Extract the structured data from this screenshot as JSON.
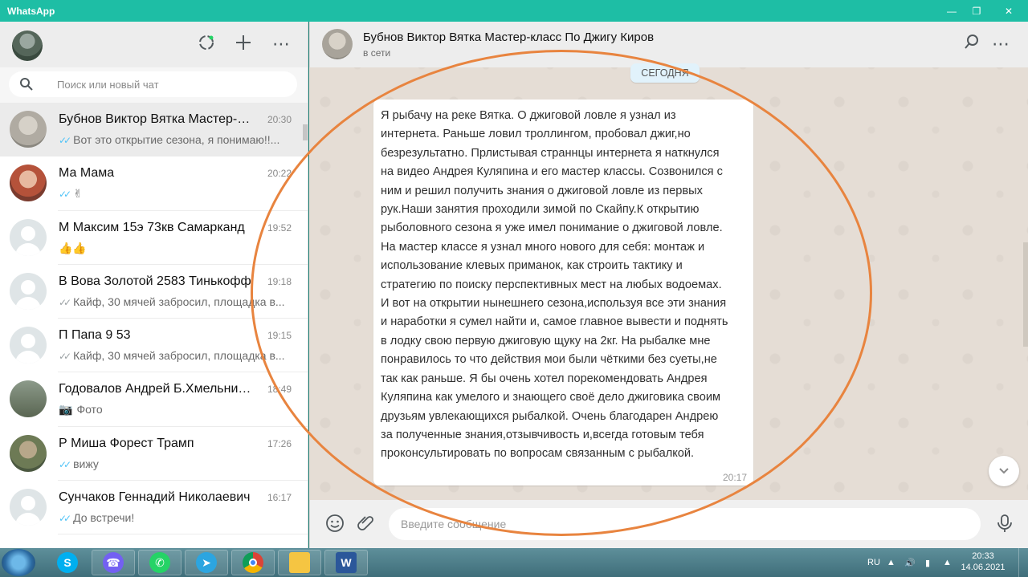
{
  "window": {
    "title": "WhatsApp"
  },
  "search": {
    "placeholder": "Поиск или новый чат"
  },
  "chats": [
    {
      "name": "Бубнов Виктор Вятка Мастер-класс По Джигу Киров",
      "time": "20:30",
      "preview": "Вот это открытие сезона, я понимаю!!...",
      "ticks": true,
      "active": true
    },
    {
      "name": "Ма Мама",
      "time": "20:22",
      "preview": "✌",
      "ticks": true
    },
    {
      "name": "М Максим 15э 73кв Самарканд",
      "time": "19:52",
      "preview": "👍👍",
      "ticks": false
    },
    {
      "name": "В Вова Золотой 2583 Тинькофф",
      "time": "19:18",
      "preview": "Кайф, 30 мячей забросил, площадка в...",
      "ticks": true
    },
    {
      "name": "П Папа 9 53",
      "time": "19:15",
      "preview": "Кайф, 30 мячей забросил, площадка в...",
      "ticks": true
    },
    {
      "name": "Годовалов Андрей Б.Хмельницкий",
      "time": "18:49",
      "preview": "Фото",
      "ticks": false,
      "photo": true
    },
    {
      "name": "Р Миша Форест Трамп",
      "time": "17:26",
      "preview": "вижу",
      "ticks": true
    },
    {
      "name": "Сунчаков Геннадий Николаевич",
      "time": "16:17",
      "preview": "До встречи!",
      "ticks": true
    }
  ],
  "conversation": {
    "contact_name": "Бубнов Виктор Вятка Мастер-класс По Джигу Киров",
    "status": "в сети",
    "date_label": "СЕГОДНЯ",
    "message_lines": [
      "Я рыбачу на реке Вятка. О джиговой ловле я узнал из",
      "интернета. Раньше ловил троллингом, пробовал джиг,но",
      "безрезультатно. Прлистывая страннцы интернета я наткнулся",
      "на видео Андрея Куляпина и его мастер классы. Созвонился с",
      "ним и решил получить знания о джиговой ловле из первых",
      "рук.Наши занятия проходили зимой по Скайпу.К открытию",
      "рыболовного сезона я уже имел понимание о джиговой ловле.",
      "На мастер классе я узнал много нового для себя: монтаж и",
      "использование клевых приманок, как строить тактику и",
      "стратегию по поиску перспективных мест на любых водоемах.",
      "И вот на открытии нынешнего сезона,используя все эти знания",
      "и наработки я сумел найти и, самое главное вывести и поднять",
      "в лодку свою первую джиговую щуку на 2кг. На рыбалке мне",
      "понравилось то что действия мои были чёткими без суеты,не",
      "так как раньше. Я бы очень хотел порекомендовать Андрея",
      "Куляпина как умелого и знающего своё дело джиговика своим",
      "друзьям увлекающихся рыбалкой. Очень благодарен Андрею",
      "за полученные знания,отзывчивость и,всегда готовым тебя",
      "проконсультировать по вопросам связанным с рыбалкой."
    ],
    "message_time": "20:17",
    "compose_placeholder": "Введите сообщение"
  },
  "taskbar": {
    "language": "RU",
    "clock_time": "20:33",
    "clock_date": "14.06.2021",
    "apps": [
      "skype",
      "viber",
      "whatsapp",
      "telegram",
      "chrome",
      "explorer",
      "word"
    ]
  },
  "icons": {
    "status": "status-icon",
    "new_chat": "plus-icon",
    "menu": "more-icon",
    "search": "search-icon",
    "emoji": "emoji-icon",
    "attach": "paperclip-icon",
    "mic": "microphone-icon"
  },
  "colors": {
    "accent": "#1ebea5",
    "tick": "#4fc3f7",
    "highlight": "#e8843f"
  }
}
